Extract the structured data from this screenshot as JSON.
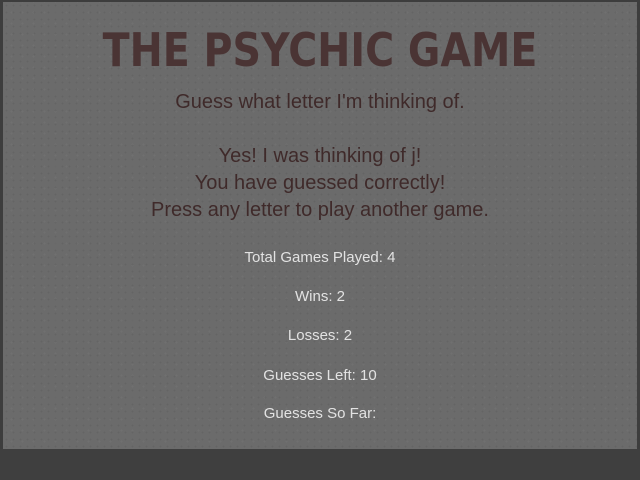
{
  "game": {
    "title": "THE PSYCHIC GAME",
    "subtitle": "Guess what letter I'm thinking of."
  },
  "result": {
    "line1": "Yes! I was thinking of j!",
    "line2": "You have guessed correctly!",
    "line3": "Press any letter to play another game."
  },
  "stats": {
    "total_games": "Total Games Played: 4",
    "wins": "Wins: 2",
    "losses": "Losses: 2",
    "guesses_left": "Guesses Left: 10",
    "guesses_so_far": "Guesses So Far:"
  },
  "colors": {
    "title": "#4a3434",
    "message": "#3f2a2a",
    "stats": "#e2e2e2",
    "panel": "#6b6b6b",
    "frame": "#3d3d3d"
  }
}
